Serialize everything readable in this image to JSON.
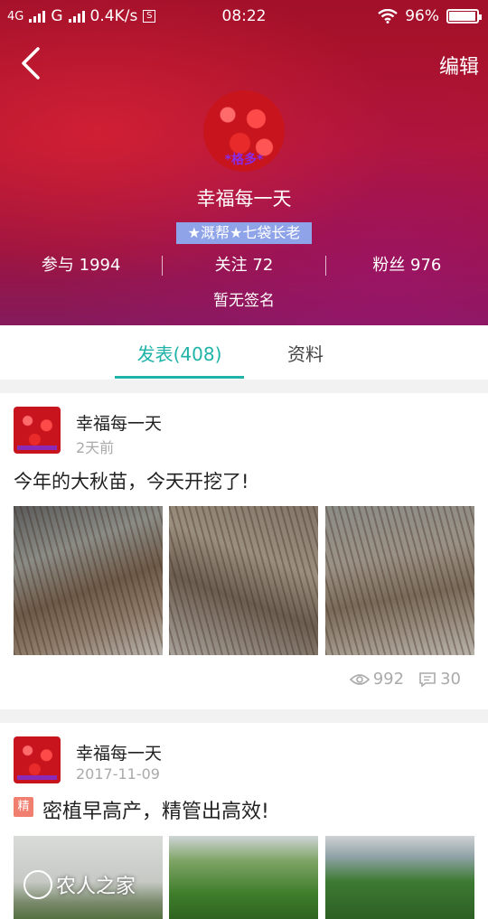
{
  "status_bar": {
    "network1": "4G",
    "network2": "G",
    "speed": "0.4K/s",
    "speed_icon": "S",
    "time": "08:22",
    "battery": "96%",
    "battery_level": 0.96
  },
  "header": {
    "back_icon": "chevron-left-icon",
    "edit_label": "编辑"
  },
  "profile": {
    "avatar_text": "*格多*",
    "username": "幸福每一天",
    "badge": "★溉帮★七袋长老",
    "stats": [
      {
        "label": "参与",
        "value": "1994"
      },
      {
        "label": "关注",
        "value": "72"
      },
      {
        "label": "粉丝",
        "value": "976"
      }
    ],
    "stat_texts": [
      "参与 1994",
      "关注 72",
      "粉丝 976"
    ],
    "signature": "暂无签名"
  },
  "tabs": [
    {
      "label": "发表(408)",
      "active": true
    },
    {
      "label": "资料",
      "active": false
    }
  ],
  "posts": [
    {
      "author": "幸福每一天",
      "time": "2天前",
      "text": "今年的大秋苗，今天开挖了!",
      "views": "992",
      "comments": "30"
    },
    {
      "author": "幸福每一天",
      "time": "2017-11-09",
      "tag": "精",
      "text": "密植早高产，精管出高效!",
      "watermark": "农人之家"
    }
  ],
  "colors": {
    "accent": "#1fb3a8",
    "banner": "#a2102a",
    "badge_bg": "#8fa3e8",
    "tag_bg": "#f07f70"
  }
}
